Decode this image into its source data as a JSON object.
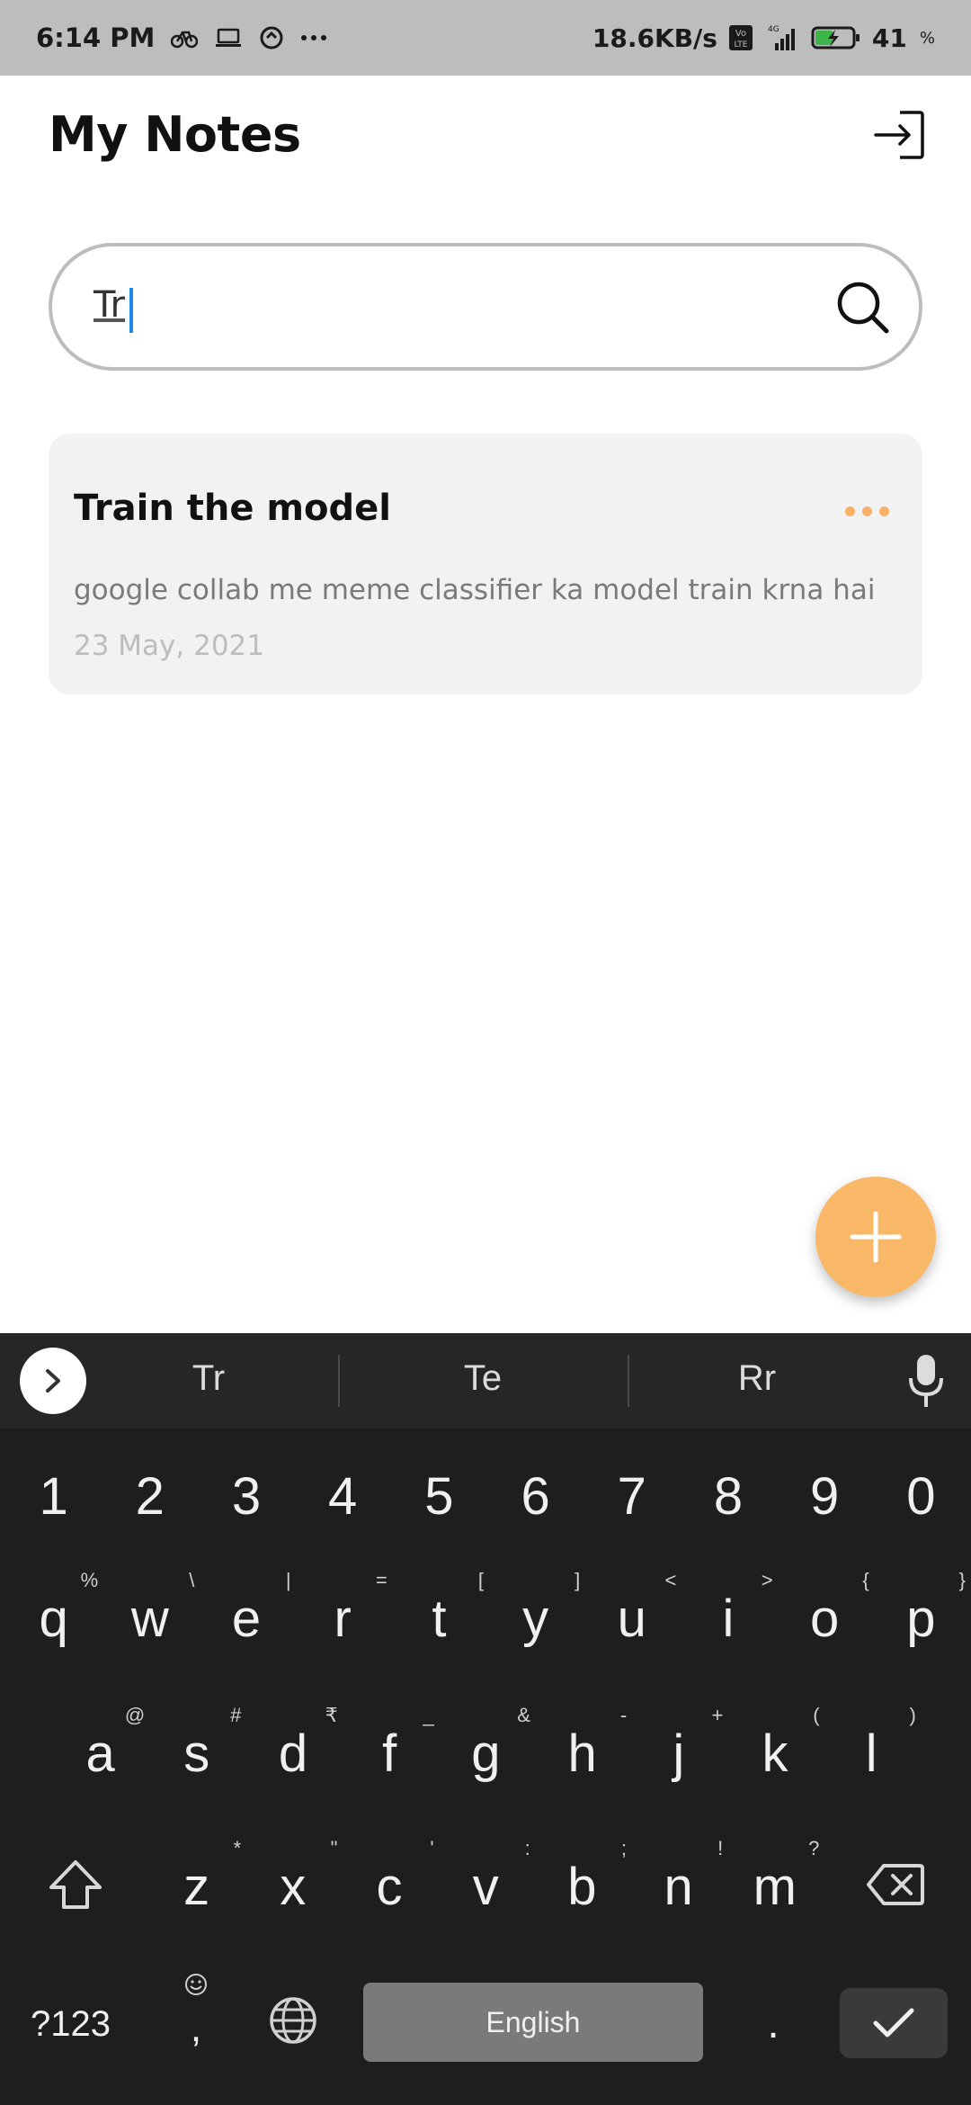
{
  "status_bar": {
    "time": "6:14 PM",
    "left_icons": [
      "bike-icon",
      "laptop-icon",
      "vpn-icon",
      "more-dots-icon"
    ],
    "network_speed": "18.6KB/s",
    "network": "4G",
    "volte_label": "Vo LTE",
    "battery_level": "41",
    "battery_unit": "%"
  },
  "header": {
    "title": "My Notes",
    "logout_icon": "logout-icon"
  },
  "search": {
    "value": "Tr",
    "icon": "search-icon"
  },
  "notes": [
    {
      "title": "Train the model",
      "body": "google collab me meme classifier ka model train krna hai",
      "date": "23 May, 2021"
    }
  ],
  "fab": {
    "icon": "plus-icon"
  },
  "keyboard": {
    "suggestions": [
      "Tr",
      "Te",
      "Rr"
    ],
    "number_row": [
      "1",
      "2",
      "3",
      "4",
      "5",
      "6",
      "7",
      "8",
      "9",
      "0"
    ],
    "row1": [
      {
        "key": "q",
        "alt": "%"
      },
      {
        "key": "w",
        "alt": "\\"
      },
      {
        "key": "e",
        "alt": "|"
      },
      {
        "key": "r",
        "alt": "="
      },
      {
        "key": "t",
        "alt": "["
      },
      {
        "key": "y",
        "alt": "]"
      },
      {
        "key": "u",
        "alt": "<"
      },
      {
        "key": "i",
        "alt": ">"
      },
      {
        "key": "o",
        "alt": "{"
      },
      {
        "key": "p",
        "alt": "}"
      }
    ],
    "row2": [
      {
        "key": "a",
        "alt": "@"
      },
      {
        "key": "s",
        "alt": "#"
      },
      {
        "key": "d",
        "alt": "₹"
      },
      {
        "key": "f",
        "alt": "_"
      },
      {
        "key": "g",
        "alt": "&"
      },
      {
        "key": "h",
        "alt": "-"
      },
      {
        "key": "j",
        "alt": "+"
      },
      {
        "key": "k",
        "alt": "("
      },
      {
        "key": "l",
        "alt": ")"
      }
    ],
    "row3": [
      {
        "key": "z",
        "alt": "*"
      },
      {
        "key": "x",
        "alt": "\""
      },
      {
        "key": "c",
        "alt": "'"
      },
      {
        "key": "v",
        "alt": ":"
      },
      {
        "key": "b",
        "alt": ";"
      },
      {
        "key": "n",
        "alt": "!"
      },
      {
        "key": "m",
        "alt": "?"
      }
    ],
    "symbols_label": "?123",
    "comma": ",",
    "space_label": "English",
    "period": "."
  },
  "colors": {
    "accent": "#f9b868",
    "caret": "#1e88e5",
    "keyboard_bg": "#1e1e1e"
  }
}
